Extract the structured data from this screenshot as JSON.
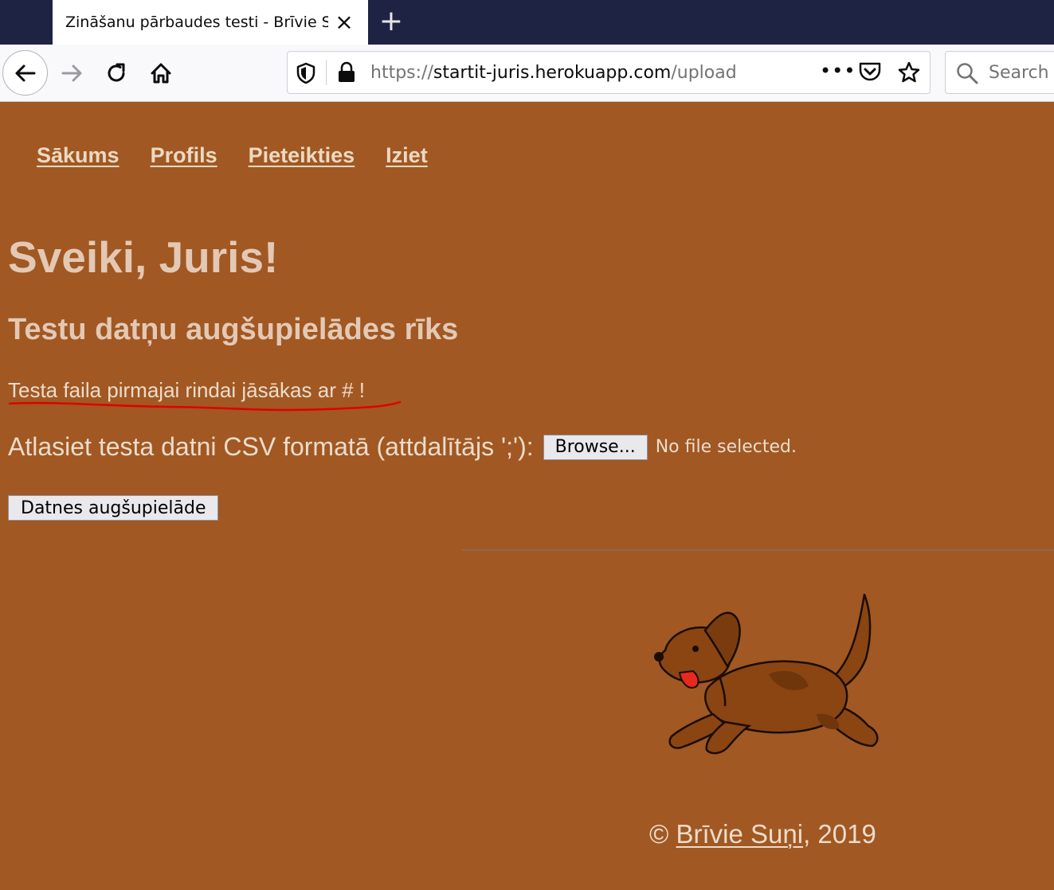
{
  "browser": {
    "tab_title": "Zināšanu pārbaudes testi - Brīvie Suņi",
    "tab_close": "×",
    "new_tab": "+",
    "url_prefix": "https://",
    "url_host": "startit-juris.herokuapp.com",
    "url_path": "/upload",
    "url_more": "•••",
    "search_placeholder": "Search"
  },
  "nav": {
    "items": [
      "Sākums",
      "Profils",
      "Pieteikties",
      "Iziet"
    ]
  },
  "main": {
    "greeting": "Sveiki, Juris!",
    "tool_title": "Testu datņu augšupielādes rīks",
    "note": "Testa faila pirmajai rindai jāsākas ar # !",
    "file_label": "Atlasiet testa datni CSV formatā (attdalītājs ';'):",
    "browse_label": "Browse...",
    "no_file_label": "No file selected.",
    "upload_label": "Datnes augšupielāde"
  },
  "footer": {
    "copyright": "©",
    "link_text": "Brīvie Suņi",
    "year_text": ", 2019"
  },
  "colors": {
    "page_bg": "#a15822",
    "text_light": "#ecdccc",
    "tabbar_bg": "#1f2343",
    "annotation_red": "#e00000"
  }
}
